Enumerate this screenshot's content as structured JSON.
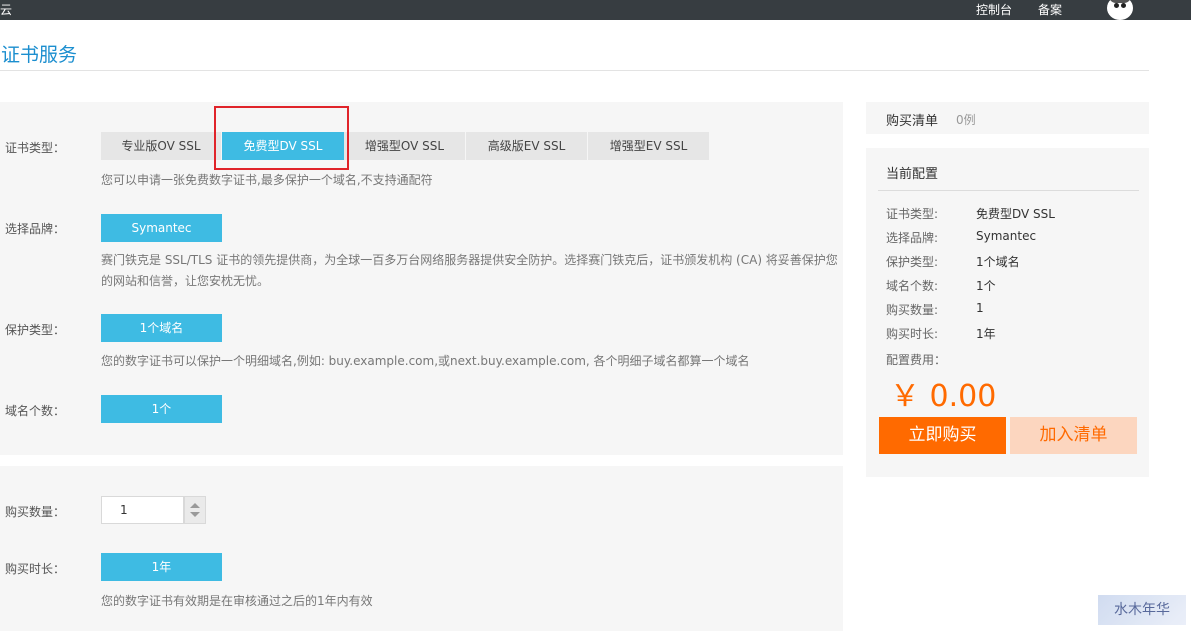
{
  "topbar": {
    "logo_fragment": "云",
    "console": "控制台",
    "filing": "备案"
  },
  "page_title": "证书服务",
  "cert_type": {
    "label": "证书类型：",
    "options": [
      "专业版OV SSL",
      "免费型DV SSL",
      "增强型OV SSL",
      "高级版EV SSL",
      "增强型EV SSL"
    ],
    "selected": "免费型DV SSL",
    "hint": "您可以申请一张免费数字证书,最多保护一个域名,不支持通配符"
  },
  "brand": {
    "label": "选择品牌：",
    "value": "Symantec",
    "hint_line1": "赛门铁克是 SSL/TLS 证书的领先提供商，为全球一百多万台网络服务器提供安全防护。选择赛门铁克后，证书颁发机构 (CA) 将妥善保护您",
    "hint_line2": "的网站和信誉，让您安枕无忧。"
  },
  "protection": {
    "label": "保护类型：",
    "value": "1个域名",
    "hint": "您的数字证书可以保护一个明细域名,例如: buy.example.com,或next.buy.example.com, 各个明细子域名都算一个域名"
  },
  "domain_count": {
    "label": "域名个数：",
    "value": "1个"
  },
  "quantity": {
    "label": "购买数量：",
    "value": "1"
  },
  "duration": {
    "label": "购买时长：",
    "value": "1年",
    "hint": "您的数字证书有效期是在审核通过之后的1年内有效"
  },
  "cart": {
    "title": "购买清单",
    "count": "0例"
  },
  "current_config": {
    "title": "当前配置",
    "rows": [
      {
        "key": "证书类型:",
        "value": "免费型DV SSL"
      },
      {
        "key": "选择品牌:",
        "value": "Symantec"
      },
      {
        "key": "保护类型:",
        "value": "1个域名"
      },
      {
        "key": "域名个数:",
        "value": "1个"
      },
      {
        "key": "购买数量:",
        "value": "1"
      },
      {
        "key": "购买时长:",
        "value": "1年"
      }
    ],
    "fee_label": "配置费用：",
    "price": "￥ 0.00",
    "buy_now": "立即购买",
    "add_to_cart": "加入清单"
  },
  "watermark": "水木年华",
  "colors": {
    "topbar": "#373d41",
    "accent_blue": "#3ebbe3",
    "title_blue": "#1b8ecf",
    "orange": "#ff6a00",
    "highlight_red": "#e0242a"
  }
}
